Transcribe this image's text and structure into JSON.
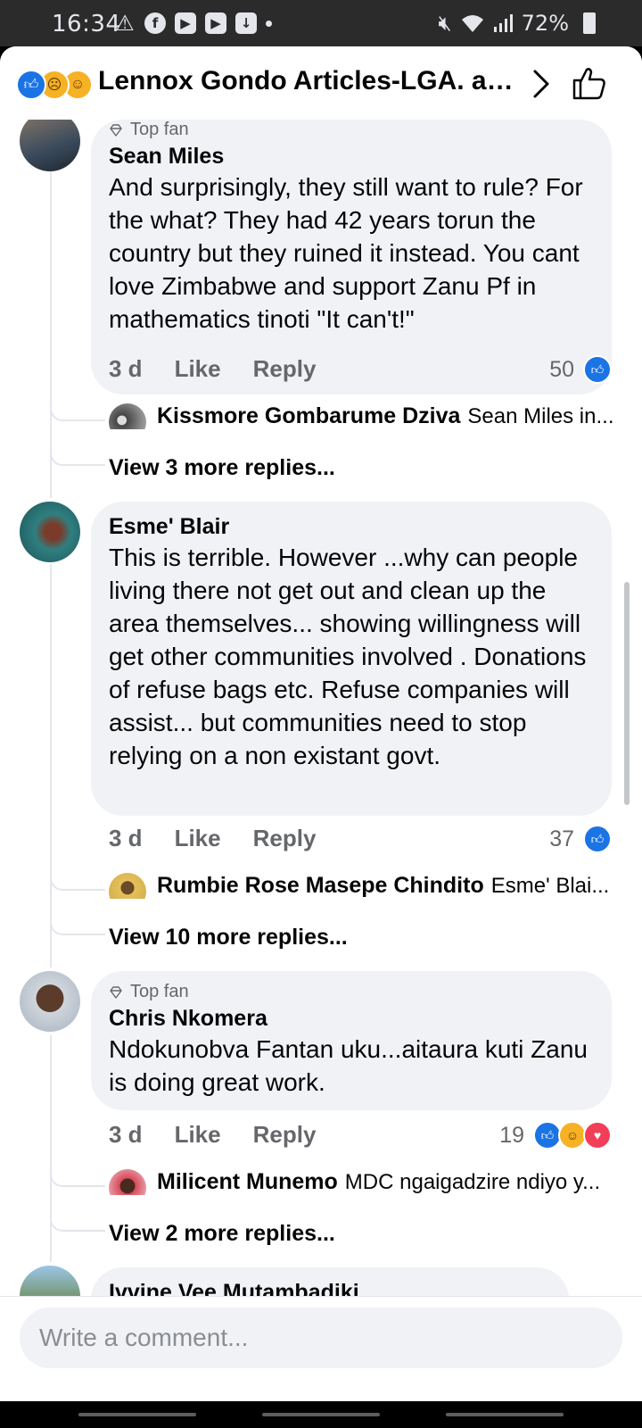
{
  "status_bar": {
    "time": "16:34",
    "battery": "72%",
    "left_icons": [
      "warning-icon",
      "facebook-icon",
      "youtube-icon",
      "youtube-icon",
      "download-icon",
      "dot-icon"
    ],
    "right_icons": [
      "mute-icon",
      "wifi-icon",
      "signal-icon",
      "battery-icon"
    ]
  },
  "header": {
    "reactions": [
      "like",
      "sad",
      "haha"
    ],
    "title": "Lennox Gondo Articles-LGA. and..."
  },
  "comments": [
    {
      "author": "Sean Miles",
      "badge": "Top fan",
      "text": "And surprisingly, they still want to rule? For the what? They had 42 years torun the country but they ruined it instead. You cant love Zimbabwe and support Zanu Pf in mathematics tinoti \"It can't!\"",
      "time": "3 d",
      "like_label": "Like",
      "reply_label": "Reply",
      "reaction_count": "50",
      "reactions": [
        "like"
      ],
      "reply_preview": {
        "author": "Kissmore Gombarume Dziva",
        "snippet": "Sean Miles in..."
      },
      "more_replies": "View 3 more replies..."
    },
    {
      "author": "Esme' Blair",
      "badge": "",
      "text": "This is terrible. However ...why can people living there not get out and clean up the area themselves... showing willingness will get other communities involved . Donations of refuse bags etc. Refuse companies will assist... but communities need to stop relying on a non existant govt.",
      "time": "3 d",
      "like_label": "Like",
      "reply_label": "Reply",
      "reaction_count": "37",
      "reactions": [
        "like"
      ],
      "reply_preview": {
        "author": "Rumbie Rose Masepe Chindito",
        "snippet": "Esme' Blai..."
      },
      "more_replies": "View 10 more replies..."
    },
    {
      "author": "Chris Nkomera",
      "badge": "Top fan",
      "text": "Ndokunobva Fantan uku...aitaura kuti Zanu is doing great work.",
      "time": "3 d",
      "like_label": "Like",
      "reply_label": "Reply",
      "reaction_count": "19",
      "reactions": [
        "like",
        "haha",
        "love"
      ],
      "reply_preview": {
        "author": "Milicent Munemo",
        "snippet": "MDC ngaigadzire ndiyo y..."
      },
      "more_replies": "View 2 more replies..."
    },
    {
      "author": "Ivvine Vee Mutambadiki"
    }
  ],
  "composer": {
    "placeholder": "Write a comment..."
  },
  "colors": {
    "accent": "#1b74e4",
    "bubble": "#f0f2f5",
    "muted_text": "#65676b",
    "love": "#f33e58",
    "haha": "#f7b125"
  }
}
